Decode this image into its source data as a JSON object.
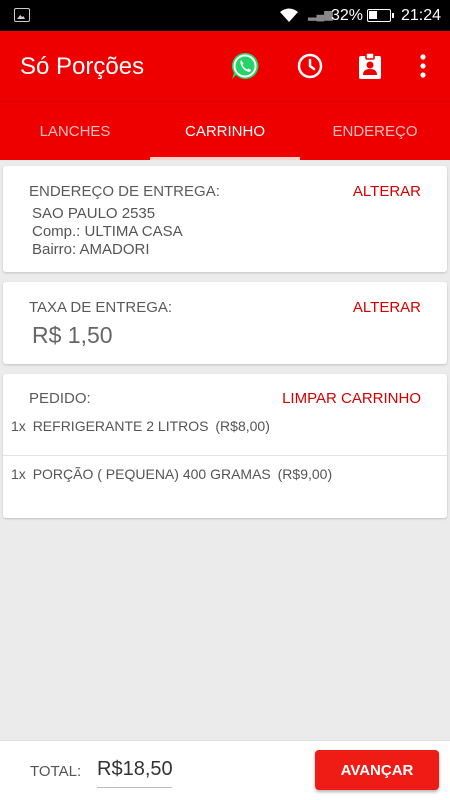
{
  "status_bar": {
    "battery_pct": "32%",
    "time": "21:24",
    "icons": [
      "image-icon",
      "wifi-icon",
      "signal-icon",
      "battery-icon"
    ]
  },
  "toolbar": {
    "title": "Só Porções",
    "actions": [
      "whatsapp-icon",
      "clock-icon",
      "contact-badge-icon",
      "more-vert-icon"
    ]
  },
  "tabs": [
    {
      "label": "LANCHES",
      "active": false
    },
    {
      "label": "CARRINHO",
      "active": true
    },
    {
      "label": "ENDEREÇO",
      "active": false
    }
  ],
  "address_card": {
    "label": "ENDEREÇO DE ENTREGA:",
    "action": "ALTERAR",
    "lines": [
      "SAO PAULO 2535",
      "Comp.: ULTIMA CASA",
      "Bairro: AMADORI"
    ]
  },
  "fee_card": {
    "label": "TAXA DE ENTREGA:",
    "action": "ALTERAR",
    "value": "R$ 1,50"
  },
  "order_card": {
    "label": "PEDIDO:",
    "action": "LIMPAR CARRINHO",
    "items": [
      {
        "qty": "1x",
        "name": "REFRIGERANTE 2 LITROS",
        "price": "(R$8,00)"
      },
      {
        "qty": "1x",
        "name": "PORÇÃO ( PEQUENA) 400 GRAMAS",
        "price": "(R$9,00)"
      }
    ]
  },
  "footer": {
    "total_label": "TOTAL:",
    "total_value": "R$18,50",
    "next_label": "AVANÇAR"
  },
  "colors": {
    "primary": "#ee0000",
    "accent_text": "#d40000",
    "button": "#ee1c14",
    "whatsapp": "#25d366"
  }
}
